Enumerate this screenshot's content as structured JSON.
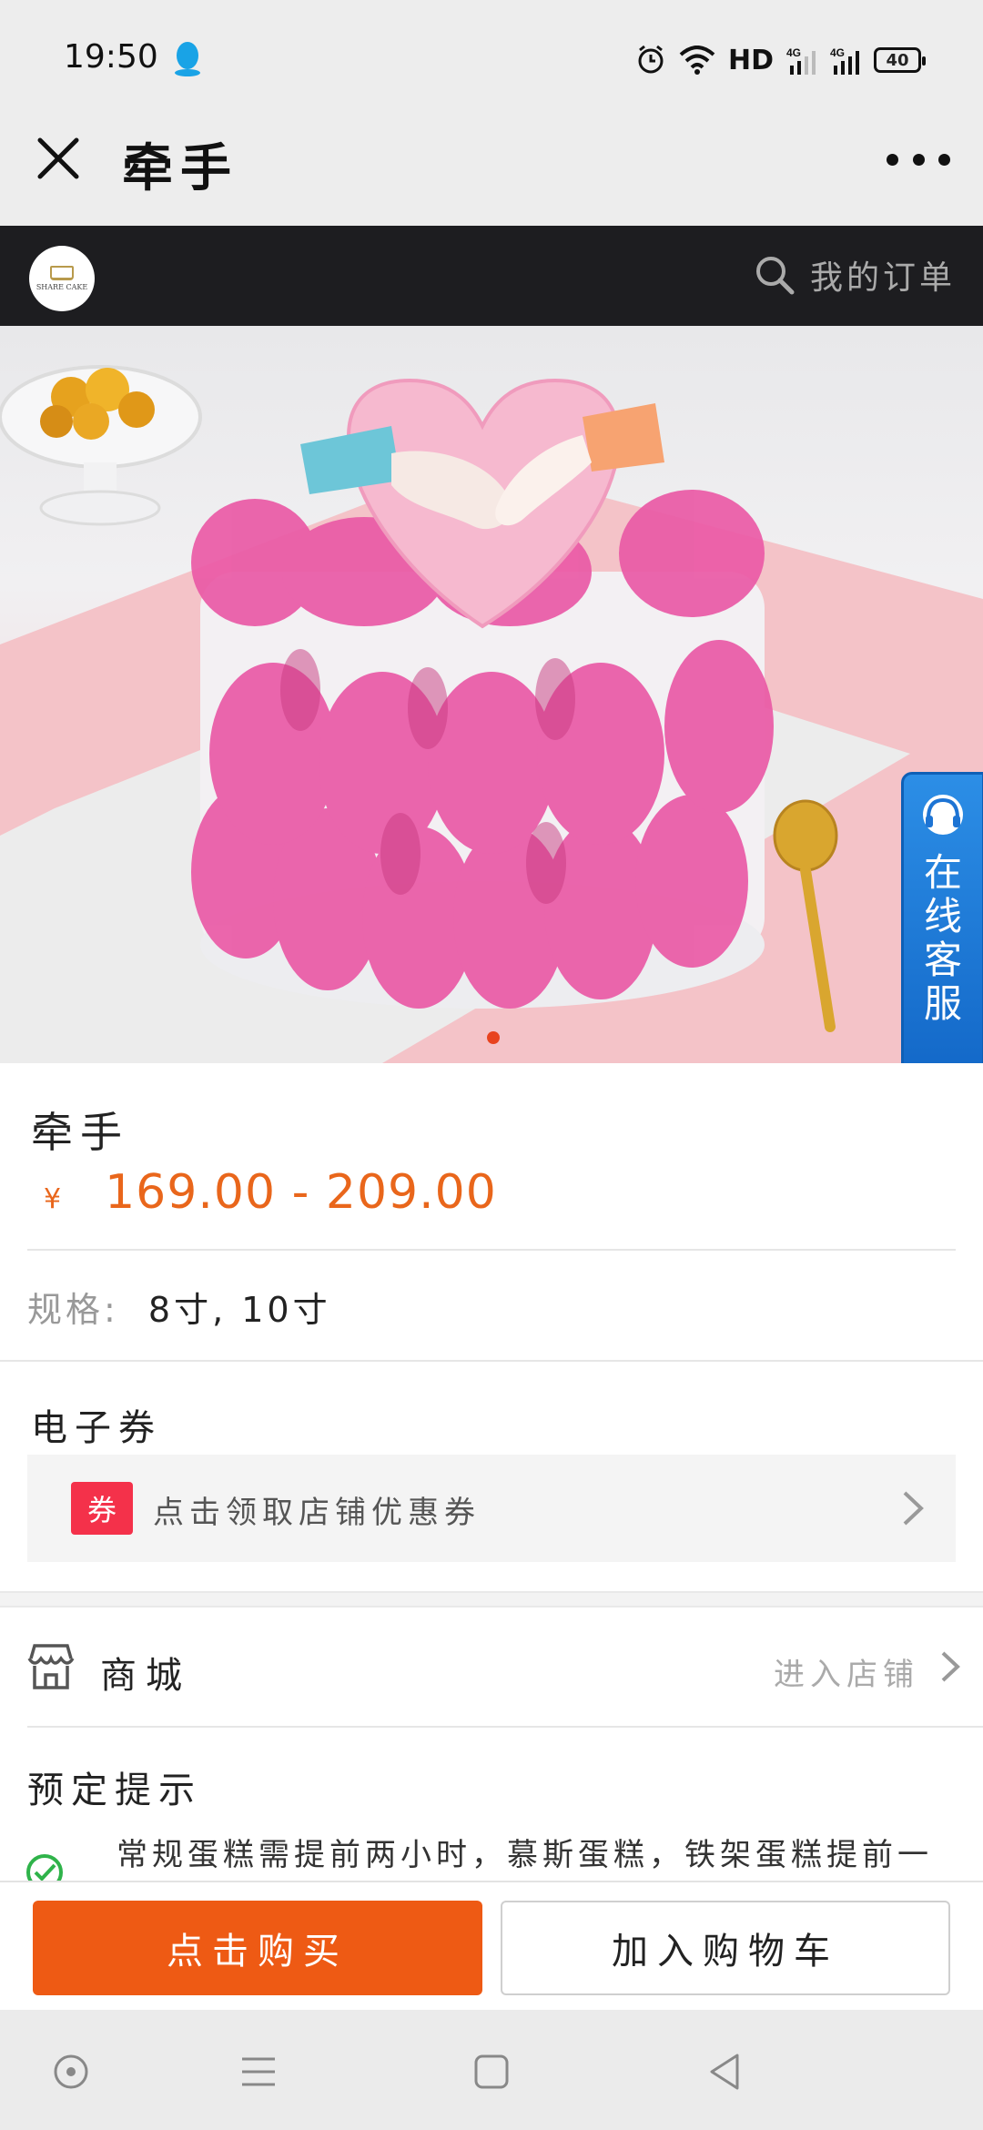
{
  "status_bar": {
    "time": "19:50",
    "network_label": "HD",
    "signal1": "4G",
    "signal2": "4G",
    "battery": "40",
    "icons": [
      "qq-icon",
      "alarm-icon",
      "wifi-icon",
      "signal-icon",
      "battery-icon"
    ]
  },
  "nav": {
    "title": "牵手",
    "close_icon": "close-icon",
    "more_icon": "more-icon"
  },
  "shop_header": {
    "logo_text": "SHARE CAKE",
    "my_orders": "我的订单"
  },
  "hero": {
    "image_description": "cake-photo",
    "carousel_index": 1
  },
  "customer_service": {
    "label": "在线客服"
  },
  "product": {
    "name": "牵手",
    "currency_symbol": "¥",
    "price_range": "169.00 - 209.00",
    "spec_label": "规格:",
    "spec_value": "8寸, 10寸"
  },
  "coupon": {
    "section_title": "电子券",
    "tag": "券",
    "text": "点击领取店铺优惠券"
  },
  "mall": {
    "label": "商城",
    "enter": "进入店铺"
  },
  "notice": {
    "title": "预定提示",
    "text": "常规蛋糕需提前两小时，慕斯蛋糕，铁架蛋糕提前一"
  },
  "actions": {
    "buy": "点击购买",
    "add_to_cart": "加入购物车"
  },
  "colors": {
    "accent": "#ee5a14",
    "price": "#e9661b",
    "coupon_tag": "#f4314a",
    "service_badge": "#1d74d4"
  }
}
